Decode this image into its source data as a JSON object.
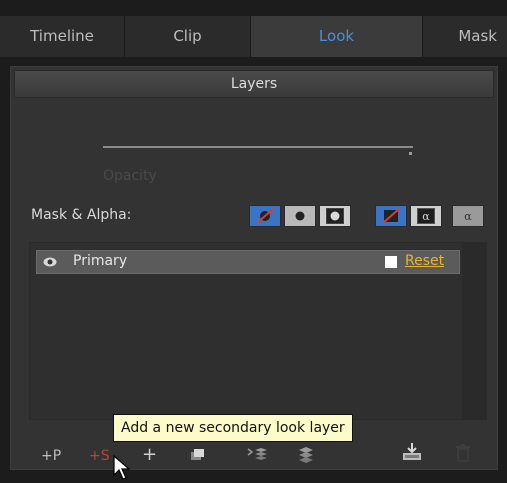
{
  "tabs": {
    "timeline": "Timeline",
    "clip": "Clip",
    "look": "Look",
    "mask": "Mask"
  },
  "panel": {
    "title": "Layers",
    "opacity_label": "Opacity",
    "mask_alpha_label": "Mask & Alpha:"
  },
  "layers": {
    "primary": {
      "name": "Primary",
      "visible": true,
      "reset_label": "Reset"
    }
  },
  "toolbar": {
    "add_primary_label": "+P",
    "add_secondary_label": "+S",
    "tooltip": "Add a new secondary look layer"
  },
  "colors": {
    "active_tab": "#4a8fd8",
    "reset_link": "#e5b52d",
    "add_secondary": "#b5463f",
    "mask_button_blue": "#3b74c4"
  }
}
